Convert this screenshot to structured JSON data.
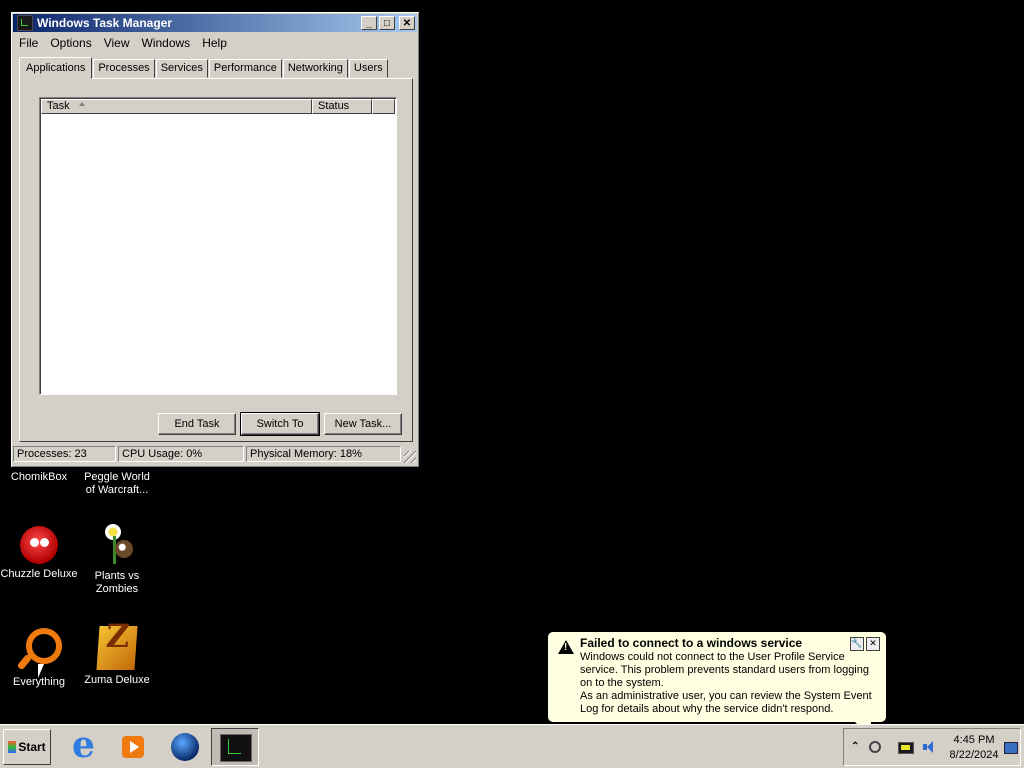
{
  "window": {
    "title": "Windows Task Manager",
    "controls": {
      "minimize": "_",
      "maximize": "□",
      "close": "✕"
    }
  },
  "menu": [
    "File",
    "Options",
    "View",
    "Windows",
    "Help"
  ],
  "tabs": [
    "Applications",
    "Processes",
    "Services",
    "Performance",
    "Networking",
    "Users"
  ],
  "active_tab": "Applications",
  "list": {
    "columns": [
      "Task",
      "Status"
    ],
    "rows": []
  },
  "buttons": {
    "end_task": "End Task",
    "switch_to": "Switch To",
    "new_task": "New Task..."
  },
  "status": {
    "processes": "Processes: 23",
    "cpu": "CPU Usage: 0%",
    "memory": "Physical Memory: 18%"
  },
  "desktop_icons": [
    {
      "label": "ChomikBox"
    },
    {
      "label": "Peggle World of Warcraft..."
    },
    {
      "label": "Chuzzle Deluxe"
    },
    {
      "label": "Plants vs Zombies"
    },
    {
      "label": "Everything"
    },
    {
      "label": "Zuma Deluxe"
    }
  ],
  "balloon": {
    "title": "Failed to connect to a windows service",
    "body": "Windows could not connect to the User Profile Service service. This problem prevents standard users from logging on to the system.",
    "body2": "As an administrative user, you can review the System Event Log for details about why the service didn't respond.",
    "settings_glyph": "🔧",
    "close_glyph": "✕"
  },
  "taskbar": {
    "start_label": "Start",
    "tray_chevron": "⌃",
    "clock_time": "4:45 PM",
    "clock_date": "8/22/2024"
  }
}
